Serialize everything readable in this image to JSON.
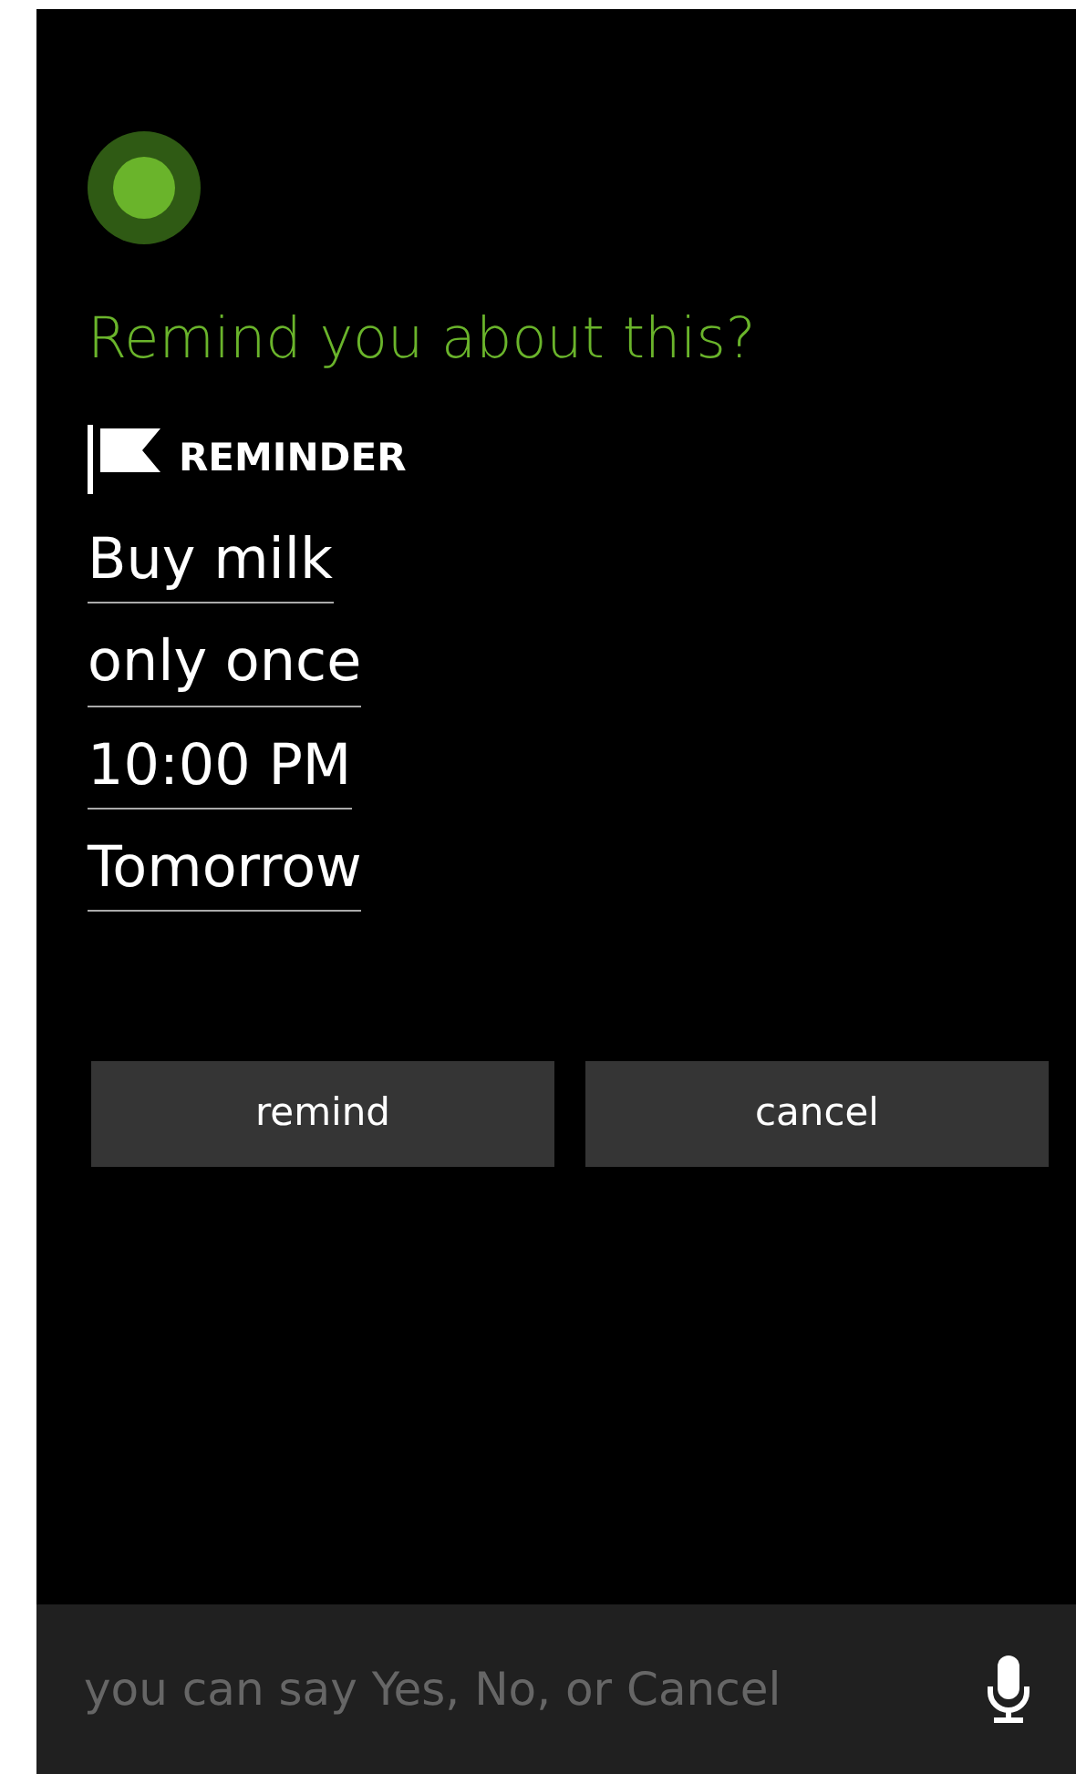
{
  "title": "Remind you about this?",
  "section": {
    "label": "REMINDER"
  },
  "fields": [
    {
      "value": "Buy milk"
    },
    {
      "value": "only once"
    },
    {
      "value": "10:00 PM"
    },
    {
      "value": "Tomorrow"
    }
  ],
  "buttons": [
    "remind",
    "cancel"
  ],
  "speech_bar": {
    "hint": "you can say Yes, No, or Cancel"
  }
}
